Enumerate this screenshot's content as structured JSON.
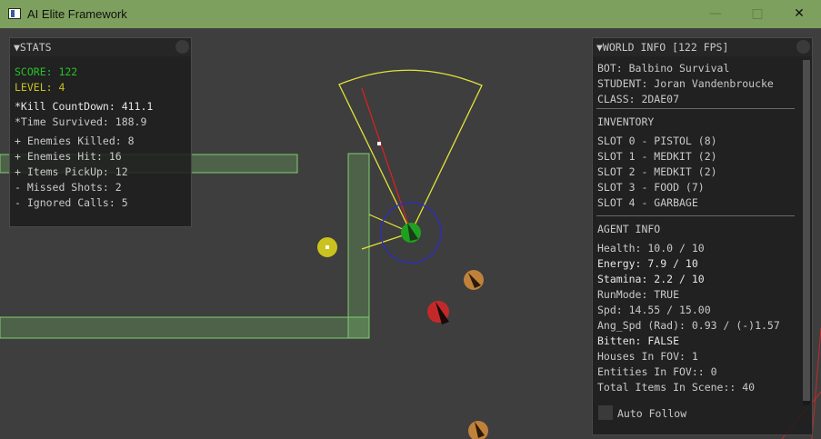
{
  "window": {
    "title": "AI Elite Framework",
    "minimize": "—",
    "maximize": "□",
    "close": "✕"
  },
  "stats": {
    "header": "▼STATS",
    "score": "SCORE: 122",
    "level": "LEVEL: 4",
    "kill_countdown": "*Kill CountDown: 411.1",
    "time_survived": "*Time Survived: 188.9",
    "enemies_killed": "+ Enemies Killed: 8",
    "enemies_hit": "+ Enemies Hit: 16",
    "items_pickup": "+ Items PickUp: 12",
    "missed_shots": "- Missed Shots: 2",
    "ignored_calls": "- Ignored Calls: 5"
  },
  "world_info": {
    "header": "▼WORLD INFO [122 FPS]",
    "bot": "BOT: Balbino Survival",
    "student": "STUDENT: Joran Vandenbroucke",
    "class": "CLASS: 2DAE07",
    "inventory_title": "INVENTORY",
    "slots": [
      "SLOT 0 - PISTOL (8)",
      "SLOT 1 - MEDKIT (2)",
      "SLOT 2 - MEDKIT (2)",
      "SLOT 3 - FOOD (7)",
      "SLOT 4 - GARBAGE"
    ],
    "agent_title": "AGENT INFO",
    "agent": [
      "Health: 10.0 / 10",
      "Energy: 7.9 / 10",
      "Stamina: 2.2 / 10",
      "RunMode: TRUE",
      "Spd: 14.55 / 15.00",
      "Ang_Spd (Rad): 0.93 / (-)1.57",
      "Bitten: FALSE",
      "Houses In FOV: 1",
      "Entities In FOV:: 0",
      "Total Items In Scene:: 40"
    ],
    "auto_follow": "Auto Follow"
  },
  "colors": {
    "titlebar": "#7ea05e",
    "score": "#27c227",
    "level": "#c9c21f",
    "wall": "#7fcf6f",
    "fov": "#e3e33a",
    "agent": "#1fa01f",
    "agent_ring": "#2a2ad0",
    "enemy_red": "#c22a2a",
    "enemy_orange": "#c0823a",
    "item_yellow": "#c9c21f"
  }
}
